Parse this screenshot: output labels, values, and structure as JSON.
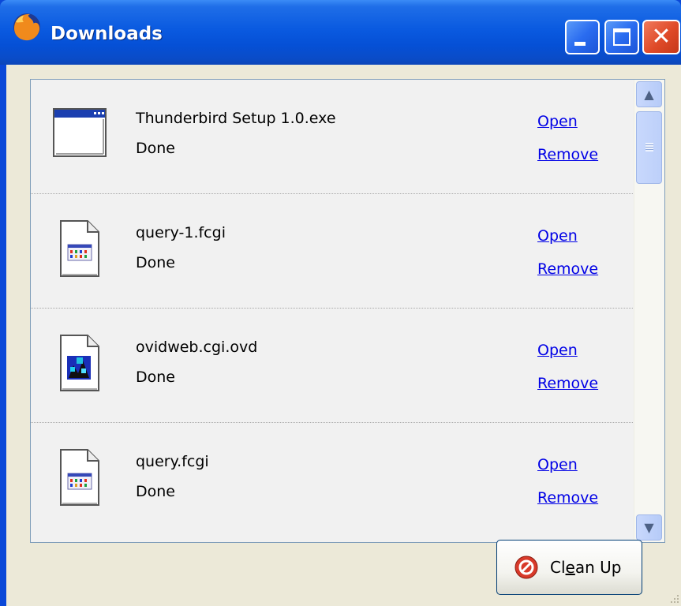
{
  "window": {
    "title": "Downloads"
  },
  "downloads": [
    {
      "name": "Thunderbird Setup 1.0.exe",
      "status": "Done",
      "open_label": "Open",
      "remove_label": "Remove",
      "icon": "application-window-icon"
    },
    {
      "name": "query-1.fcgi",
      "status": "Done",
      "open_label": "Open",
      "remove_label": "Remove",
      "icon": "document-file-icon"
    },
    {
      "name": "ovidweb.cgi.ovd",
      "status": "Done",
      "open_label": "Open",
      "remove_label": "Remove",
      "icon": "ovid-file-icon"
    },
    {
      "name": "query.fcgi",
      "status": "Done",
      "open_label": "Open",
      "remove_label": "Remove",
      "icon": "document-file-icon"
    }
  ],
  "cleanup": {
    "label_before": "Cl",
    "label_accesskey": "e",
    "label_after": "an Up"
  },
  "colors": {
    "titlebar": "#0a5ae0",
    "link": "#0000e6",
    "client_bg": "#ece9d8",
    "close_button": "#df4a28"
  }
}
